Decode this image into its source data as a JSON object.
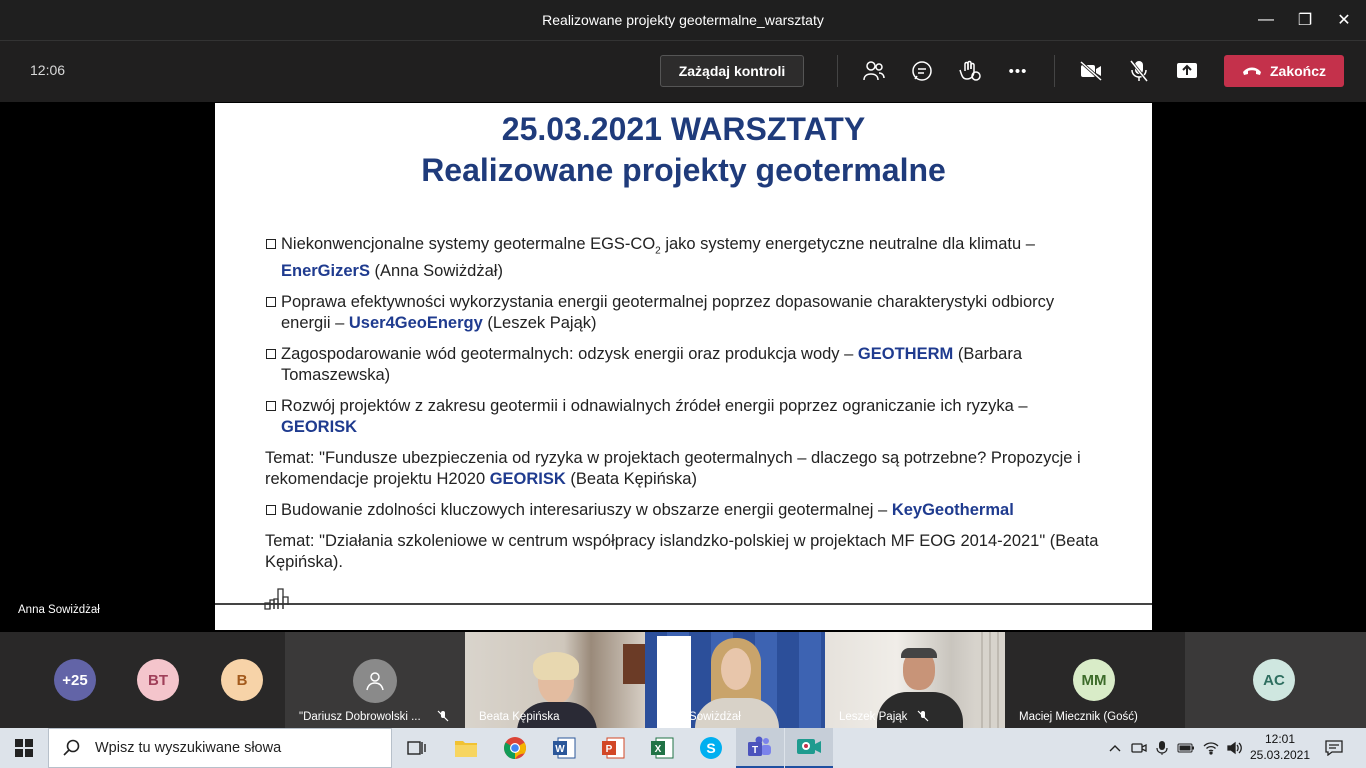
{
  "window": {
    "title": "Realizowane projekty geotermalne_warsztaty",
    "min_glyph": "—",
    "max_glyph": "❐",
    "close_glyph": "✕"
  },
  "toolbar": {
    "timer": "12:06",
    "request_control_label": "Zażądaj kontroli",
    "more_glyph": "•••",
    "end_call_label": "Zakończ"
  },
  "slide": {
    "title_line1": "25.03.2021 WARSZTATY",
    "title_line2": "Realizowane projekty geotermalne",
    "items": [
      {
        "pre": "Niekonwencjonalne systemy geotermalne EGS-CO",
        "sub": "2",
        "mid": " jako systemy energetyczne neutralne dla klimatu – ",
        "hl": "EnerGizerS",
        "post": " (Anna Sowiżdżał)"
      },
      {
        "pre": "Poprawa efektywności wykorzystania energii geotermalnej poprzez dopasowanie charakterystyki odbiorcy energii – ",
        "hl": "User4GeoEnergy",
        "post": " (Leszek Pająk)"
      },
      {
        "pre": "Zagospodarowanie wód geotermalnych: odzysk energii oraz produkcja wody – ",
        "hl": "GEOTHERM",
        "post": " (Barbara Tomaszewska)"
      },
      {
        "pre": "Rozwój projektów z zakresu geotermii i odnawialnych źródeł energii poprzez ograniczanie ich ryzyka – ",
        "hl": "GEORISK",
        "post": ""
      }
    ],
    "topic1": {
      "pre": "Temat: \"Fundusze ubezpieczenia od ryzyka w projektach geotermalnych – dlaczego są potrzebne? Propozycje i rekomendacje projektu H2020 ",
      "hl": "GEORISK",
      "post": " (Beata Kępińska)"
    },
    "item5": {
      "pre": "Budowanie zdolności kluczowych interesariuszy w obszarze energii geotermalnej – ",
      "hl": "KeyGeothermal"
    },
    "topic2": "Temat: \"Działania szkoleniowe w centrum współpracy islandzko-polskiej w projektach MF EOG 2014-2021\" (Beata Kępińska)."
  },
  "presenter_name": "Anna Sowiżdżał",
  "participants": {
    "overflow": {
      "label": "+25",
      "color": "#6264a7"
    },
    "bt": {
      "label": "BT",
      "color": "#f4c5cc"
    },
    "b": {
      "label": "B",
      "color": "#f7d3a8"
    },
    "dariusz": "\"Dariusz Dobrowolski ...",
    "beata": "Beata Kępińska",
    "anna": "Anna Sowiżdżał",
    "leszek": "Leszek Pająk",
    "maciej": {
      "initials": "MM",
      "name": "Maciej Miecznik (Gość)",
      "color": "#d9ecc8"
    },
    "ac": {
      "initials": "AC",
      "color": "#cfe7e0"
    }
  },
  "taskbar": {
    "search_placeholder": "Wpisz tu wyszukiwane słowa",
    "time": "12:01",
    "date": "25.03.2021"
  }
}
